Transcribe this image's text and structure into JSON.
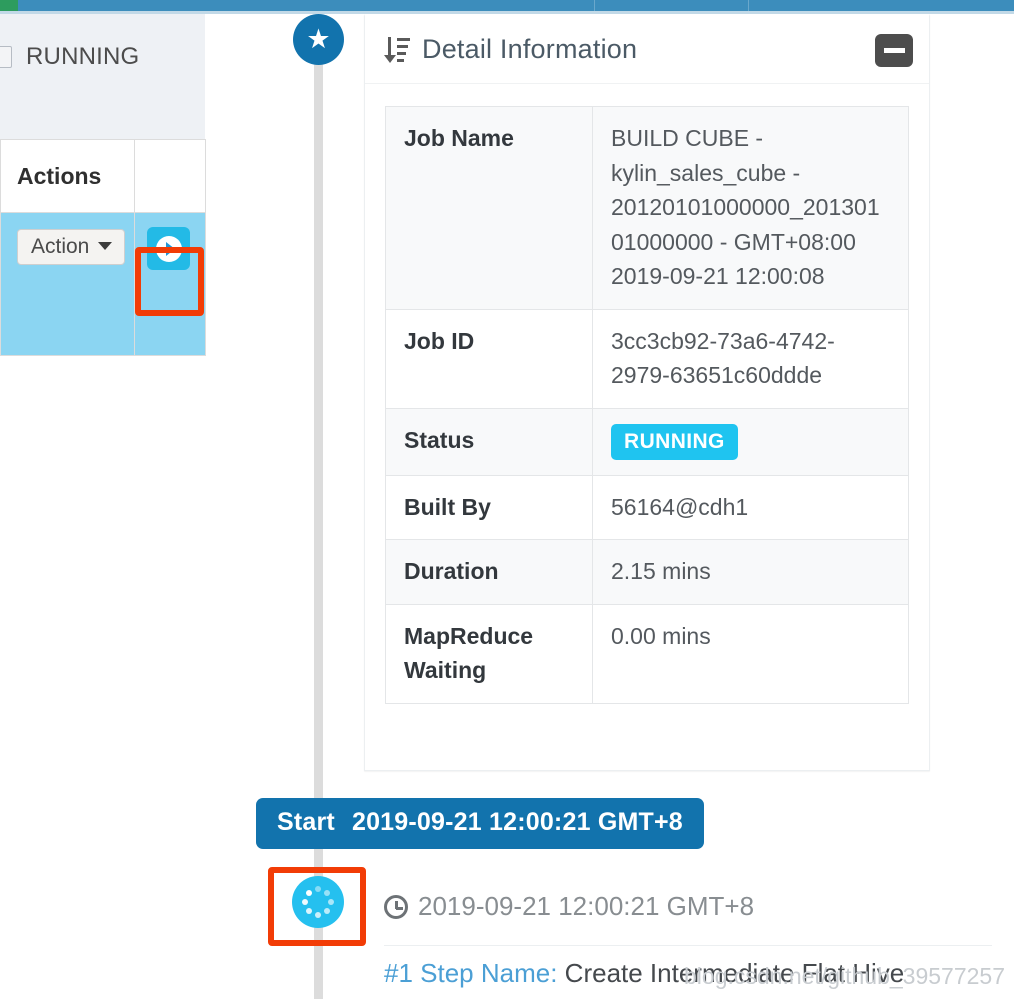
{
  "navbar": {
    "accent_color": "#3c8dbc",
    "logo_color": "#2d9c5e"
  },
  "job_list": {
    "filter_checkbox_label": "RUNNING",
    "column_header_actions": "Actions",
    "action_button_label": "Action",
    "expand_icon": "chevron-right-icon",
    "row_highlight_color": "#8bd5f2"
  },
  "timeline": {
    "start_node_icon": "star-icon",
    "step_node_icon": "spinner-icon"
  },
  "detail_panel": {
    "title": "Detail Information",
    "title_icon": "sort-descending-icon",
    "collapse_icon": "minus-icon",
    "rows": [
      {
        "key": "Job Name",
        "value": "BUILD CUBE - kylin_sales_cube - 20120101000000_20130101000000 - GMT+08:00 2019-09-21 12:00:08",
        "type": "text"
      },
      {
        "key": "Job ID",
        "value": "3cc3cb92-73a6-4742-2979-63651c60ddde",
        "type": "text"
      },
      {
        "key": "Status",
        "value": "RUNNING",
        "type": "badge",
        "badge_color": "#1fc4f0"
      },
      {
        "key": "Built By",
        "value": "56164@cdh1",
        "type": "text"
      },
      {
        "key": "Duration",
        "value": "2.15 mins",
        "type": "text"
      },
      {
        "key": "MapReduce Waiting",
        "value": "0.00 mins",
        "type": "text"
      }
    ]
  },
  "start_marker": {
    "label": "Start",
    "timestamp": "2019-09-21 12:00:21 GMT+8",
    "background_color": "#1273ad"
  },
  "step": {
    "clock_icon": "clock-icon",
    "timestamp": "2019-09-21 12:00:21 GMT+8",
    "number_label": "#1 Step Name:",
    "name": "Create Intermediate Flat Hive"
  },
  "watermark": {
    "text": "blog.csdn.net/github_39577257"
  }
}
